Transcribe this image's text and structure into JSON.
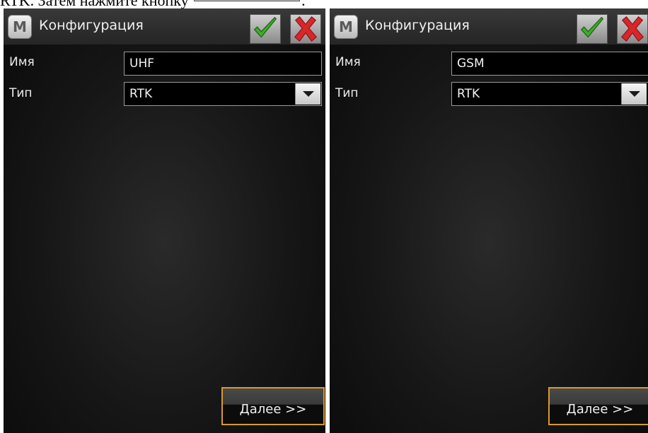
{
  "doc": {
    "before": "RTK. Затем нажмите кнопку",
    "after": "."
  },
  "screens": [
    {
      "title": "Конфигурация",
      "app_icon_letter": "M",
      "name_label": "Имя",
      "name_value": "UHF",
      "type_label": "Тип",
      "type_value": "RTK",
      "next_label": "Далее >>"
    },
    {
      "title": "Конфигурация",
      "app_icon_letter": "M",
      "name_label": "Имя",
      "name_value": "GSM",
      "type_label": "Тип",
      "type_value": "RTK",
      "next_label": "Далее >>"
    }
  ],
  "colors": {
    "accent_border": "#d89a2a",
    "ok_green": "#3fae2a",
    "cancel_red": "#d8262a"
  },
  "icons": {
    "ok": "checkmark-icon",
    "cancel": "close-icon",
    "dropdown": "chevron-down-icon"
  }
}
